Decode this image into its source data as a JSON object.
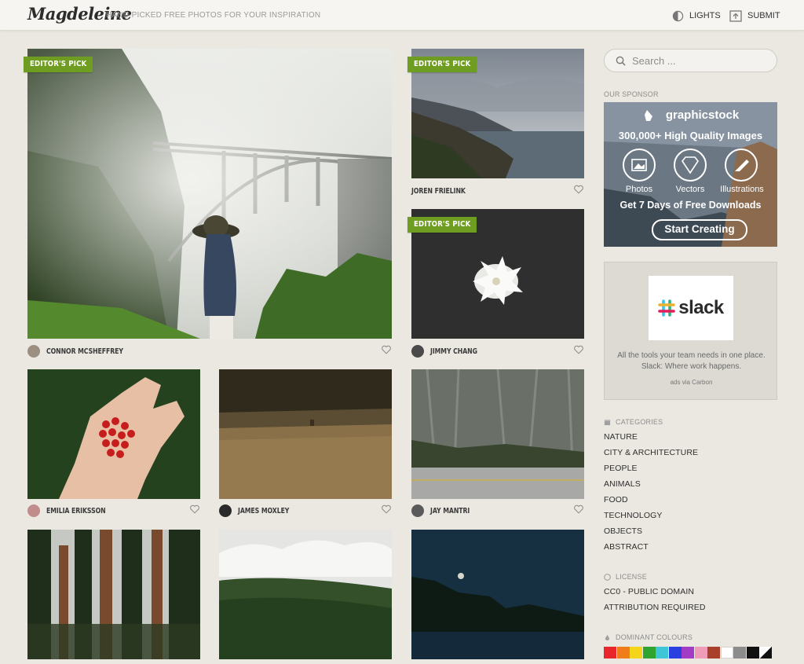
{
  "header": {
    "logo": "Magdeleine",
    "tagline": "HAND-PICKED FREE PHOTOS FOR YOUR INSPIRATION",
    "lights_label": "LIGHTS",
    "submit_label": "SUBMIT"
  },
  "badge_label": "EDITOR'S PICK",
  "photos": [
    {
      "author": "CONNOR MCSHEFFREY",
      "editors_pick": true,
      "icon": "heart-icon"
    },
    {
      "author": "JOREN FRIELINK",
      "editors_pick": true,
      "icon": "heart-icon"
    },
    {
      "author": "JIMMY CHANG",
      "editors_pick": true,
      "icon": "heart-icon"
    },
    {
      "author": "EMILIA ERIKSSON",
      "editors_pick": false,
      "icon": "heart-icon"
    },
    {
      "author": "JAMES MOXLEY",
      "editors_pick": false,
      "icon": "heart-icon"
    },
    {
      "author": "JAY MANTRI",
      "editors_pick": false,
      "icon": "heart-icon"
    }
  ],
  "sidebar": {
    "search_placeholder": "Search ...",
    "sponsor_label": "OUR SPONSOR",
    "sponsor_ad": {
      "brand": "graphicstock",
      "headline": "300,000+ High Quality Images",
      "features": [
        "Photos",
        "Vectors",
        "Illustrations"
      ],
      "offer": "Get 7 Days of Free Downloads",
      "cta": "Start Creating"
    },
    "carbon_ad": {
      "brand": "slack",
      "text": "All the tools your team needs in one place. Slack: Where work happens.",
      "via": "ads via Carbon"
    },
    "categories_label": "CATEGORIES",
    "categories": [
      "NATURE",
      "CITY & ARCHITECTURE",
      "PEOPLE",
      "ANIMALS",
      "FOOD",
      "TECHNOLOGY",
      "OBJECTS",
      "ABSTRACT"
    ],
    "license_label": "LICENSE",
    "licenses": [
      "CC0 - PUBLIC DOMAIN",
      "ATTRIBUTION REQUIRED"
    ],
    "colours_label": "DOMINANT COLOURS",
    "colours": [
      "#e8262b",
      "#f07d19",
      "#f5d51a",
      "#2fa52f",
      "#3ec6d6",
      "#2a3fe0",
      "#a23cc7",
      "#f09bb8",
      "#a8402c",
      "#ffffff",
      "#8c8c8c",
      "#111111",
      "bw"
    ]
  }
}
